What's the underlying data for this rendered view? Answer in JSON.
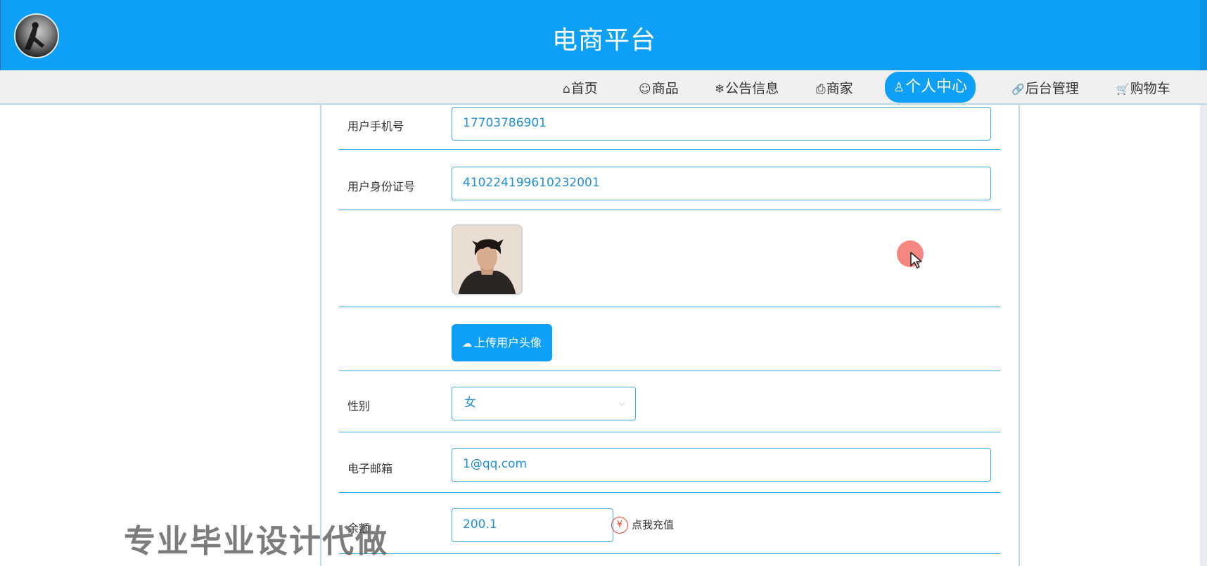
{
  "header": {
    "title": "电商平台",
    "brand_color": "#0ea0f6"
  },
  "nav": {
    "items": [
      {
        "label": "首页",
        "icon": "home-icon",
        "glyph": "⌂"
      },
      {
        "label": "商品",
        "icon": "product-icon",
        "glyph": "☺"
      },
      {
        "label": "公告信息",
        "icon": "snowflake-icon",
        "glyph": "❄"
      },
      {
        "label": "商家",
        "icon": "printer-icon",
        "glyph": "⎙"
      },
      {
        "label": "个人中心",
        "icon": "user-icon",
        "glyph": "♙"
      },
      {
        "label": "后台管理",
        "icon": "link-icon",
        "glyph": "🔗"
      },
      {
        "label": "购物车",
        "icon": "cart-icon",
        "glyph": "🛒"
      }
    ],
    "active": "个人中心"
  },
  "form": {
    "phone": {
      "label": "用户手机号",
      "value": "17703786901"
    },
    "id_card": {
      "label": "用户身份证号",
      "value": "410224199610232001"
    },
    "upload_label": "上传用户头像",
    "gender": {
      "label": "性别",
      "value": "女"
    },
    "email": {
      "label": "电子邮箱",
      "value": "1@qq.com"
    },
    "balance": {
      "label": "余额",
      "value": "200.1"
    },
    "recharge_label": "点我充值",
    "recharge_icon": "¥"
  },
  "watermark": "专业毕业设计代做"
}
